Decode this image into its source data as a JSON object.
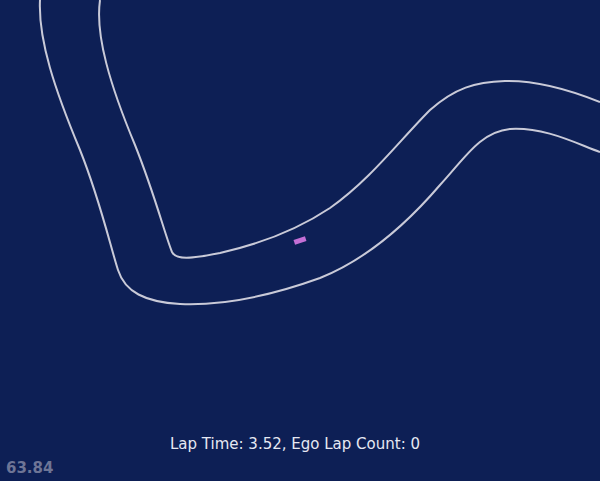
{
  "hud": {
    "lap_info": "Lap Time: 3.52, Ego Lap Count: 0"
  },
  "fps": {
    "value": "63.84"
  }
}
